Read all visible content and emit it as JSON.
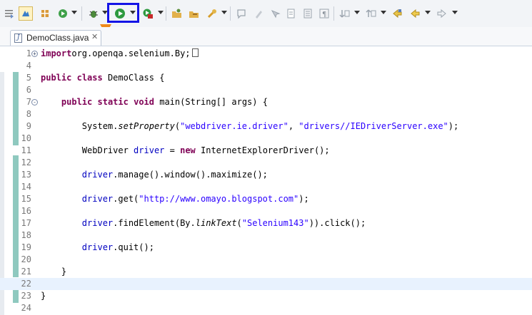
{
  "toolbar": {
    "icons": [
      "outline-icon",
      "toggle-mark-icon",
      "new-package-icon",
      "refresh-run-icon",
      "debug-icon",
      "run-icon",
      "coverage-icon",
      "open-type-icon",
      "open-task-icon",
      "search-icon",
      "annotation-icon",
      "highlight-icon",
      "block-select-icon",
      "whitespace-icon",
      "pilcrow-icon",
      "next-annotation-icon",
      "prev-annotation-icon",
      "last-edit-icon",
      "back-icon",
      "forward-icon"
    ],
    "highlighted": "run-button"
  },
  "tab": {
    "label": "DemoClass.java",
    "close": "✕"
  },
  "editor": {
    "line_numbers": [
      "1",
      "4",
      "5",
      "6",
      "7",
      "8",
      "9",
      "10",
      "11",
      "12",
      "13",
      "14",
      "15",
      "16",
      "17",
      "18",
      "19",
      "20",
      "21",
      "22",
      "23",
      "24"
    ],
    "lines": [
      {
        "n": "1",
        "fold": "+",
        "parts": [
          [
            "kw",
            "import"
          ],
          [
            "",
            "org.openqa.selenium.By;"
          ]
        ]
      },
      {
        "n": "4",
        "parts": []
      },
      {
        "n": "5",
        "parts": [
          [
            "kw",
            "public"
          ],
          [
            "",
            " "
          ],
          [
            "kw",
            "class"
          ],
          [
            "",
            " DemoClass {"
          ]
        ]
      },
      {
        "n": "6",
        "parts": []
      },
      {
        "n": "7",
        "fold": "-",
        "parts": [
          [
            "",
            "    "
          ],
          [
            "kw",
            "public"
          ],
          [
            "",
            " "
          ],
          [
            "kw",
            "static"
          ],
          [
            "",
            " "
          ],
          [
            "kw",
            "void"
          ],
          [
            "",
            " main(String[] args) {"
          ]
        ]
      },
      {
        "n": "8",
        "parts": []
      },
      {
        "n": "9",
        "parts": [
          [
            "",
            "        System."
          ],
          [
            "it",
            "setProperty"
          ],
          [
            "",
            "("
          ],
          [
            "str",
            "\"webdriver.ie.driver\""
          ],
          [
            "",
            ", "
          ],
          [
            "str",
            "\"drivers//IEDriverServer.exe\""
          ],
          [
            "",
            ");"
          ]
        ]
      },
      {
        "n": "10",
        "parts": []
      },
      {
        "n": "11",
        "parts": [
          [
            "",
            "        WebDriver "
          ],
          [
            "fld",
            "driver"
          ],
          [
            "",
            " = "
          ],
          [
            "kw",
            "new"
          ],
          [
            "",
            " InternetExplorerDriver();"
          ]
        ]
      },
      {
        "n": "12",
        "parts": []
      },
      {
        "n": "13",
        "parts": [
          [
            "",
            "        "
          ],
          [
            "fld",
            "driver"
          ],
          [
            "",
            ".manage().window().maximize();"
          ]
        ]
      },
      {
        "n": "14",
        "parts": []
      },
      {
        "n": "15",
        "parts": [
          [
            "",
            "        "
          ],
          [
            "fld",
            "driver"
          ],
          [
            "",
            ".get("
          ],
          [
            "str",
            "\"http://www.omayo.blogspot.com\""
          ],
          [
            "",
            ");"
          ]
        ]
      },
      {
        "n": "16",
        "parts": []
      },
      {
        "n": "17",
        "parts": [
          [
            "",
            "        "
          ],
          [
            "fld",
            "driver"
          ],
          [
            "",
            ".findElement(By."
          ],
          [
            "it",
            "linkText"
          ],
          [
            "",
            "("
          ],
          [
            "str",
            "\"Selenium143\""
          ],
          [
            "",
            "))."
          ],
          [
            "",
            "click();"
          ]
        ]
      },
      {
        "n": "18",
        "parts": []
      },
      {
        "n": "19",
        "parts": [
          [
            "",
            "        "
          ],
          [
            "fld",
            "driver"
          ],
          [
            "",
            ".quit();"
          ]
        ]
      },
      {
        "n": "20",
        "parts": []
      },
      {
        "n": "21",
        "parts": [
          [
            "",
            "    }"
          ]
        ]
      },
      {
        "n": "22",
        "parts": []
      },
      {
        "n": "23",
        "parts": [
          [
            "",
            "}"
          ]
        ]
      },
      {
        "n": "24",
        "parts": []
      }
    ]
  },
  "colors": {
    "keyword": "#7f0055",
    "string": "#2a00ff",
    "field": "#0000c0",
    "highlight_box": "#1414e6",
    "change_bar": "#8fc9bf"
  }
}
